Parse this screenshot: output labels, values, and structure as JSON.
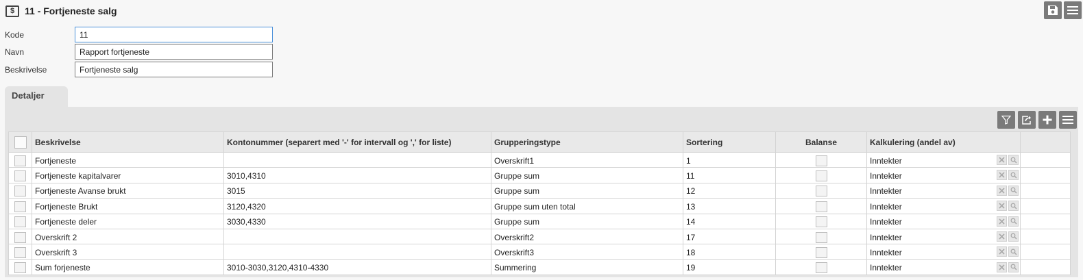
{
  "header": {
    "title": "11 - Fortjeneste salg",
    "icon": "dollar-document-icon"
  },
  "toolbar": {
    "save_icon": "floppy-disk-icon",
    "menu_icon": "hamburger-menu-icon"
  },
  "form": {
    "kode_label": "Kode",
    "kode_value": "11",
    "navn_label": "Navn",
    "navn_value": "Rapport fortjeneste",
    "beskrivelse_label": "Beskrivelse",
    "beskrivelse_value": "Fortjeneste salg"
  },
  "tabs": [
    {
      "label": "Detaljer",
      "active": true
    }
  ],
  "grid_toolbar": {
    "icons": [
      "filter-icon",
      "export-icon",
      "add-icon",
      "menu-icon"
    ]
  },
  "table": {
    "columns": {
      "beskrivelse": "Beskrivelse",
      "kontonummer": "Kontonummer (separert med '-' for intervall og ',' for liste)",
      "grupperingstype": "Grupperingstype",
      "sortering": "Sortering",
      "balanse": "Balanse",
      "kalkulering": "Kalkulering (andel av)"
    },
    "rows": [
      {
        "beskrivelse": "Fortjeneste",
        "kontonummer": "",
        "grupperingstype": "Overskrift1",
        "sortering": "1",
        "kalkulering": "Inntekter"
      },
      {
        "beskrivelse": "Fortjeneste kapitalvarer",
        "kontonummer": "3010,4310",
        "grupperingstype": "Gruppe sum",
        "sortering": "11",
        "kalkulering": "Inntekter"
      },
      {
        "beskrivelse": "Fortjeneste Avanse brukt",
        "kontonummer": "3015",
        "grupperingstype": "Gruppe sum",
        "sortering": "12",
        "kalkulering": "Inntekter"
      },
      {
        "beskrivelse": "Fortjeneste Brukt",
        "kontonummer": "3120,4320",
        "grupperingstype": "Gruppe sum uten total",
        "sortering": "13",
        "kalkulering": "Inntekter"
      },
      {
        "beskrivelse": "Fortjeneste deler",
        "kontonummer": "3030,4330",
        "grupperingstype": "Gruppe sum",
        "sortering": "14",
        "kalkulering": "Inntekter"
      },
      {
        "beskrivelse": "Overskrift 2",
        "kontonummer": "",
        "grupperingstype": "Overskrift2",
        "sortering": "17",
        "kalkulering": "Inntekter"
      },
      {
        "beskrivelse": "Overskrift 3",
        "kontonummer": "",
        "grupperingstype": "Overskrift3",
        "sortering": "18",
        "kalkulering": "Inntekter"
      },
      {
        "beskrivelse": "Sum forjeneste",
        "kontonummer": "3010-3030,3120,4310-4330",
        "grupperingstype": "Summering",
        "sortering": "19",
        "kalkulering": "Inntekter"
      }
    ]
  },
  "colors": {
    "button_bg": "#7a7a7a",
    "panel_bg": "#e4e4e4",
    "focus_border": "#4a90d9"
  }
}
